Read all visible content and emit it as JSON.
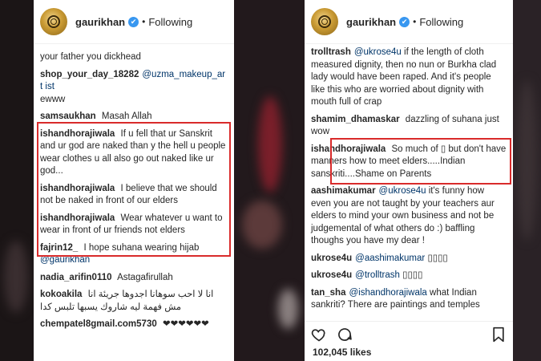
{
  "left": {
    "header": {
      "username": "gaurikhan",
      "verified_mark": "✔",
      "separator": "•",
      "follow_state": "Following"
    },
    "comments": [
      {
        "user": "",
        "text": "your father you dickhead"
      },
      {
        "user": "shop_your_day_18282",
        "mention": "@uzma_makeup_art ist",
        "text": "ewww"
      },
      {
        "user": "samsaukhan",
        "text": "Masah Allah"
      },
      {
        "user": "ishandhorajiwala",
        "text": "If u fell that ur Sanskrit and ur god are naked than y the hell u people wear clothes u all also go out naked like ur god..."
      },
      {
        "user": "ishandhorajiwala",
        "text": "I believe that we should not be naked in front of our elders"
      },
      {
        "user": "ishandhorajiwala",
        "text": "Wear whatever u want to wear in front of ur friends not elders"
      },
      {
        "user": "fajrin12_",
        "text": "I hope suhana wearing hijab",
        "mention": "@gaurikhan"
      },
      {
        "user": "nadia_arifin0110",
        "text": "Astagafirullah"
      },
      {
        "user": "kokoakila",
        "text": "انا لا احب سوهانا اجدوها جريئة انا مش فهمة ليه شاروك يسبها تلبس كدا"
      },
      {
        "user": "chempatel8gmail.com5730",
        "text": "❤❤❤❤❤❤"
      }
    ]
  },
  "right": {
    "header": {
      "username": "gaurikhan",
      "verified_mark": "✔",
      "separator": "•",
      "follow_state": "Following"
    },
    "comments": [
      {
        "user": "trolltrash",
        "mention": "@ukrose4u",
        "text": "if the length of cloth measured dignity, then no nun or Burkha clad lady would have been raped. And it's people like this who are worried about dignity with mouth full of crap"
      },
      {
        "user": "shamim_dhamaskar",
        "text": "dazzling of suhana just wow"
      },
      {
        "user": "ishandhorajiwala",
        "text": "So much of ▯ but don't have manners how to meet elders.....Indian sanskriti....Shame on Parents"
      },
      {
        "user": "aashimakumar",
        "mention": "@ukrose4u",
        "text": "it's funny how even you are not taught by your teachers aur elders to mind your own business and not be judgemental of what others do :) baffling thoughs you have my dear !"
      },
      {
        "user": "ukrose4u",
        "mention": "@aashimakumar",
        "text": "▯▯▯▯"
      },
      {
        "user": "ukrose4u",
        "mention": "@trolltrash",
        "text": "▯▯▯▯"
      },
      {
        "user": "tan_sha",
        "mention": "@ishandhorajiwala",
        "text": "what Indian sankriti? There are paintings and temples"
      }
    ],
    "likes": "102,045 likes"
  }
}
